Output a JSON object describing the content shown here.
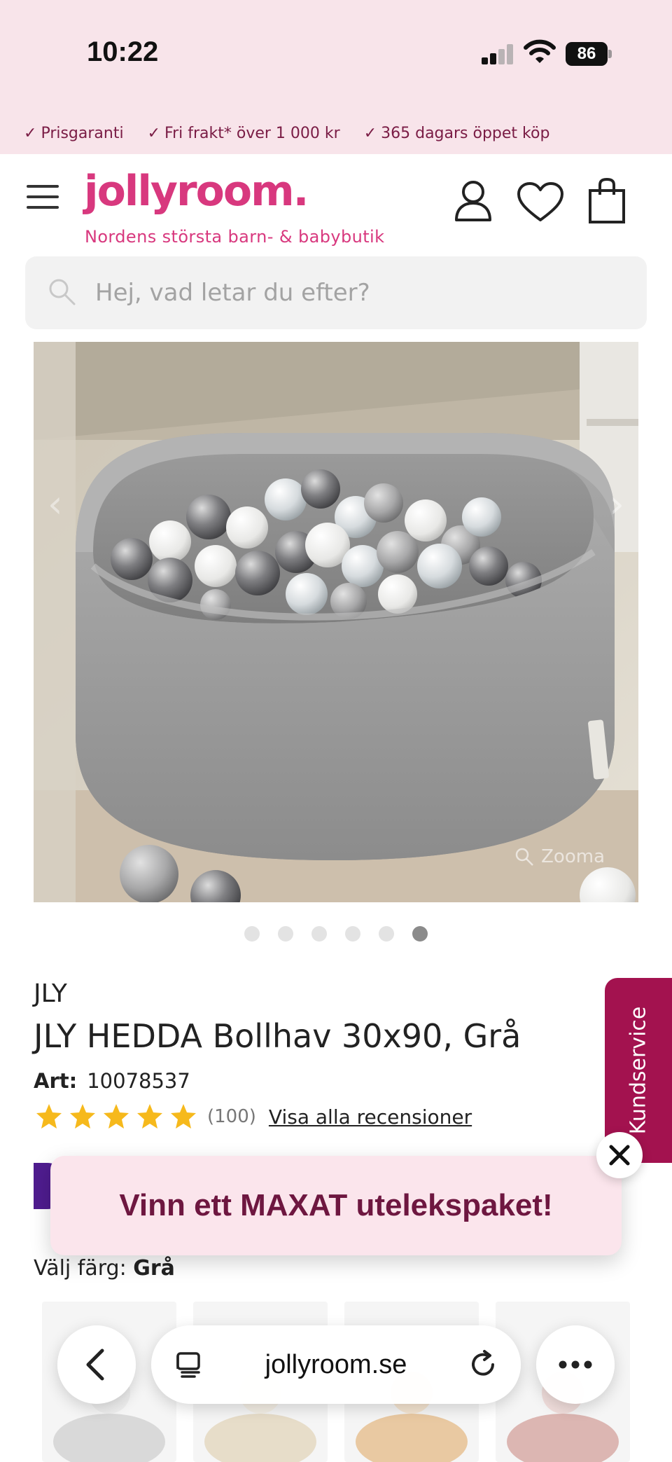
{
  "status_bar": {
    "time": "10:22",
    "battery": "86"
  },
  "promo": {
    "items": [
      "Prisgaranti",
      "Fri frakt* över 1 000 kr",
      "365 dagars öppet köp"
    ]
  },
  "header": {
    "logo": "jollyroom.",
    "tagline": "Nordens största barn- & babybutik"
  },
  "search": {
    "placeholder": "Hej, vad letar du efter?"
  },
  "gallery": {
    "zoom_label": "Zooma",
    "total_images": 6,
    "active_index": 5
  },
  "product": {
    "brand": "JLY",
    "title": "JLY HEDDA Bollhav 30x90, Grå",
    "art_label": "Art:",
    "art_number": "10078537",
    "rating_stars": 5,
    "review_count": "(100)",
    "reviews_link": "Visa alla recensioner",
    "color_label": "Välj färg:",
    "color_value": "Grå"
  },
  "banner": {
    "text": "Vinn ett MAXAT utelekspaket!"
  },
  "kundservice": {
    "label": "Kundservice"
  },
  "browser": {
    "url": "jollyroom.se"
  },
  "colors": {
    "brand_pink": "#d8387e",
    "promo_text": "#7a1c45",
    "kundservice_bg": "#a3124f",
    "star": "#f6b91c",
    "banner_text": "#6e1740"
  }
}
